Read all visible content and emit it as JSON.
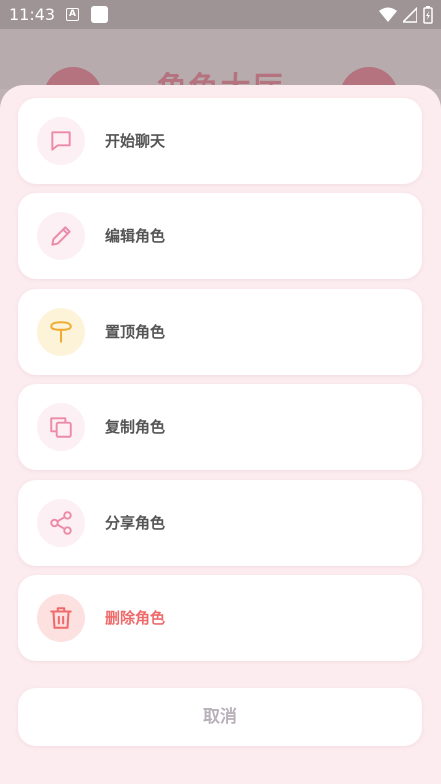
{
  "status_bar": {
    "time": "11:43",
    "a_badge": "A"
  },
  "backdrop": {
    "title": "角色大厅"
  },
  "menu": {
    "items": [
      {
        "label": "开始聊天",
        "icon": "chat-bubble-icon",
        "color": "#ec8aa8",
        "bg": "#fdf0f4"
      },
      {
        "label": "编辑角色",
        "icon": "pencil-icon",
        "color": "#ec8aa8",
        "bg": "#fdf0f4"
      },
      {
        "label": "置顶角色",
        "icon": "pin-icon",
        "color": "#f0ad35",
        "bg": "#fdf3d9"
      },
      {
        "label": "复制角色",
        "icon": "copy-icon",
        "color": "#ec8aa8",
        "bg": "#fdf0f4"
      },
      {
        "label": "分享角色",
        "icon": "share-icon",
        "color": "#ec8aa8",
        "bg": "#fdf0f4"
      },
      {
        "label": "删除角色",
        "icon": "trash-icon",
        "color": "#ef6b6b",
        "bg": "#fde0e0"
      }
    ],
    "cancel_label": "取消"
  }
}
